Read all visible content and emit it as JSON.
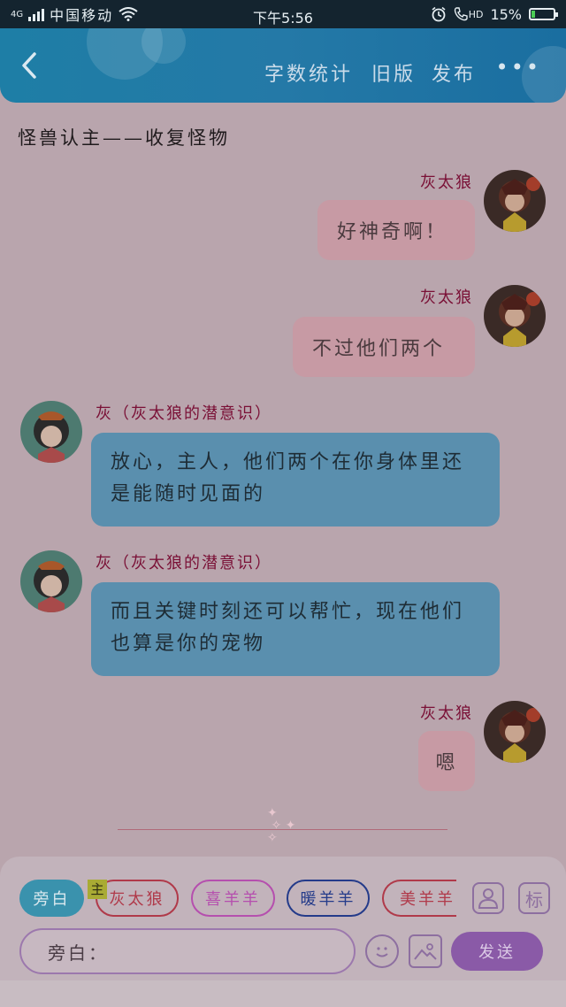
{
  "status_bar": {
    "network": "4G",
    "carrier": "中国移动",
    "time": "下午5:56",
    "hd": "HD",
    "battery": "15%",
    "battery_level": 0.15
  },
  "header": {
    "back_icon": "chevron-left-icon",
    "word_count": "字数统计",
    "old_version": "旧版",
    "publish": "发布",
    "more": "•••"
  },
  "title": "怪兽认主——收复怪物",
  "messages": [
    {
      "side": "right",
      "name": "灰太狼",
      "text": "好神奇啊！"
    },
    {
      "side": "right",
      "name": "灰太狼",
      "text": "不过他们两个"
    },
    {
      "side": "left",
      "name": "灰（灰太狼的潜意识）",
      "text": "放心，主人，他们两个在你身体里还是能随时见面的"
    },
    {
      "side": "left",
      "name": "灰（灰太狼的潜意识）",
      "text": "而且关键时刻还可以帮忙，现在他们也算是你的宠物"
    },
    {
      "side": "right",
      "name": "灰太狼",
      "text": "嗯"
    }
  ],
  "roles": {
    "narration": "旁白",
    "main_tag": "主",
    "chips": [
      "灰太狼",
      "喜羊羊",
      "暖羊羊",
      "美羊羊"
    ],
    "chip_colors": [
      "#b03a4a",
      "#b54fae",
      "#243b8a",
      "#b03a4a"
    ]
  },
  "input": {
    "placeholder": "旁白："
  },
  "send_button": "发送",
  "tool_icons": [
    "person-icon",
    "tag-icon",
    "emoji-icon",
    "image-icon"
  ],
  "tag_icon_label": "标"
}
